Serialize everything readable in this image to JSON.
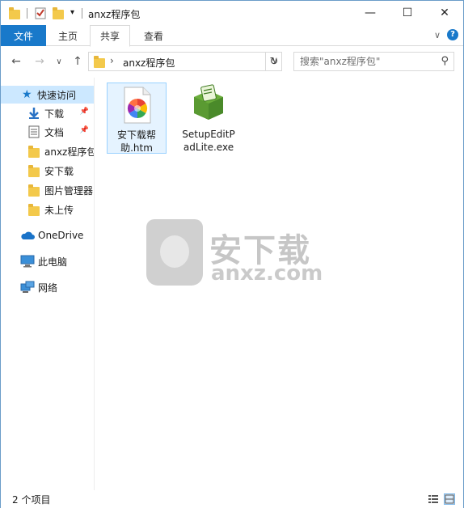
{
  "window": {
    "title": "anxz程序包",
    "controls": {
      "minimize": "—",
      "maximize": "☐",
      "close": "✕"
    }
  },
  "ribbon": {
    "tabs": [
      "文件",
      "主页",
      "共享",
      "查看"
    ],
    "active_tab": "共享",
    "expand_glyph": "∨",
    "help_glyph": "?"
  },
  "address": {
    "crumb_separator": "›",
    "path": "anxz程序包",
    "dropdown_glyph": "∨",
    "refresh_glyph": "↻"
  },
  "search": {
    "placeholder": "搜索\"anxz程序包\""
  },
  "nav": {
    "quick_access": "快速访问",
    "items": [
      {
        "label": "下载",
        "icon": "download-arrow-icon",
        "pinned": true
      },
      {
        "label": "文档",
        "icon": "document-icon",
        "pinned": true
      },
      {
        "label": "anxz程序包",
        "icon": "folder-icon",
        "pinned": false
      },
      {
        "label": "安下载",
        "icon": "folder-icon",
        "pinned": false
      },
      {
        "label": "图片管理器",
        "icon": "folder-icon",
        "pinned": false
      },
      {
        "label": "未上传",
        "icon": "folder-icon",
        "pinned": false
      }
    ],
    "onedrive": "OneDrive",
    "this_pc": "此电脑",
    "network": "网络"
  },
  "files": [
    {
      "name": "安下载帮助.htm",
      "display": "安下载帮\n助.htm",
      "icon": "htm-file-icon",
      "selected": true
    },
    {
      "name": "SetupEditPadLite.exe",
      "display": "SetupEditP\nadLite.exe",
      "icon": "installer-box-icon",
      "selected": false
    }
  ],
  "watermark": {
    "cn": "安下载",
    "en": "anxz.com"
  },
  "status": {
    "count_text": "2 个项目"
  },
  "colors": {
    "accent": "#1979ca",
    "folder": "#f3c94b",
    "selected_bg": "#cce8ff"
  }
}
